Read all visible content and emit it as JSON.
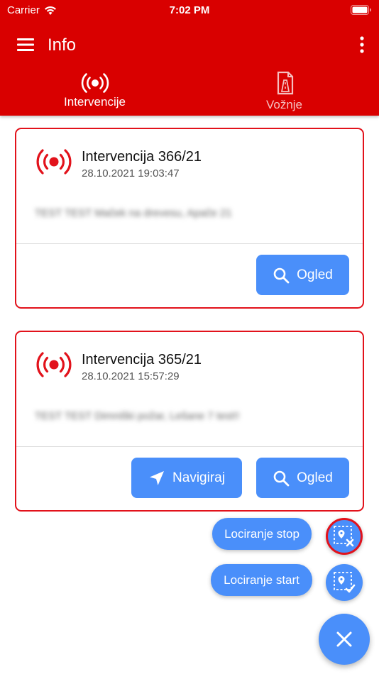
{
  "status_bar": {
    "carrier": "Carrier",
    "time": "7:02 PM"
  },
  "appbar": {
    "title": "Info"
  },
  "tabs": [
    {
      "label": "Intervencije",
      "icon": "alarm-broadcast-icon",
      "active": true
    },
    {
      "label": "Vožnje",
      "icon": "document-road-icon",
      "active": false
    }
  ],
  "cards": [
    {
      "title": "Intervencija 366/21",
      "date": "28.10.2021 19:03:47",
      "description": "TEST TEST Maček na drevesu, Apače 21",
      "buttons": {
        "view": "Ogled"
      }
    },
    {
      "title": "Intervencija 365/21",
      "date": "28.10.2021 15:57:29",
      "description": "TEST TEST Dimniški požar, Lešane 7 test!!",
      "buttons": {
        "navigate": "Navigiraj",
        "view": "Ogled"
      }
    }
  ],
  "fab": {
    "stop_label": "Lociranje stop",
    "start_label": "Lociranje start"
  },
  "colors": {
    "primary_red": "#d90000",
    "accent_blue": "#4a8ffa",
    "card_border": "#e2121b"
  }
}
